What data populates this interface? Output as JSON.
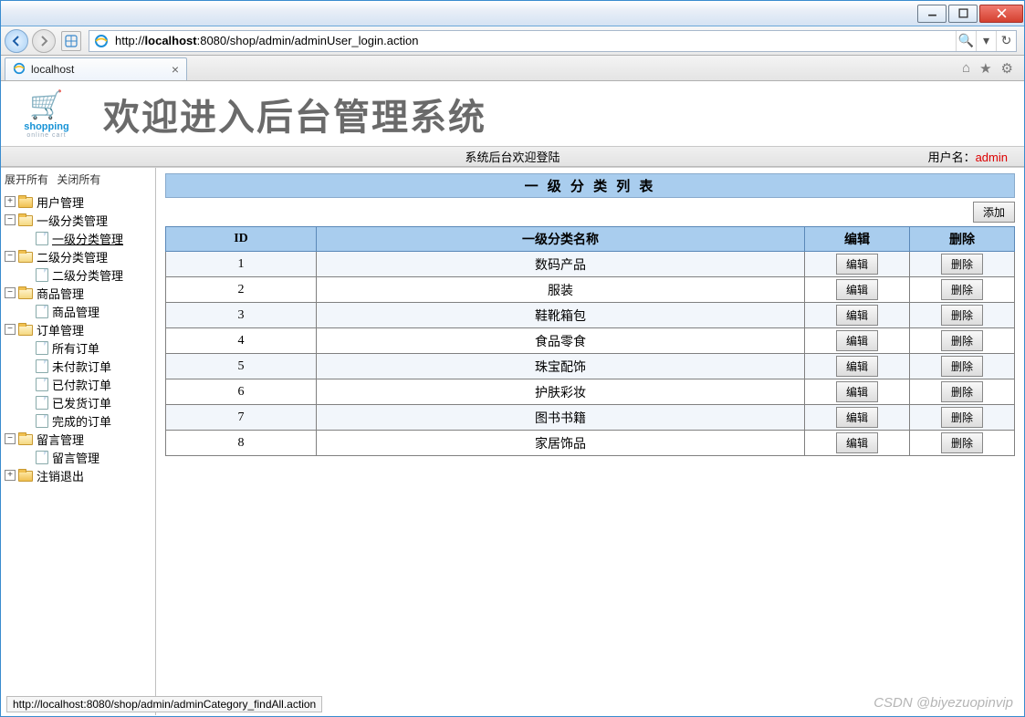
{
  "window": {
    "minimize": "",
    "maximize": "",
    "close": ""
  },
  "browser": {
    "url_pre": "http://",
    "url_host": "localhost",
    "url_post": ":8080/shop/admin/adminUser_login.action",
    "tab_title": "localhost",
    "status": "http://localhost:8080/shop/admin/adminCategory_findAll.action"
  },
  "banner": {
    "logo": "shopping",
    "logo_sub": "online cart",
    "title": "欢迎进入后台管理系统"
  },
  "infobar": {
    "welcome": "系统后台欢迎登陆",
    "user_label": "用户名：",
    "username": "admin"
  },
  "tree": {
    "expand": "展开所有",
    "collapse": "关闭所有",
    "nodes": [
      {
        "label": "用户管理",
        "children": [],
        "collapsed": true
      },
      {
        "label": "一级分类管理",
        "children": [
          {
            "label": "一级分类管理",
            "active": true
          }
        ]
      },
      {
        "label": "二级分类管理",
        "children": [
          {
            "label": "二级分类管理"
          }
        ]
      },
      {
        "label": "商品管理",
        "children": [
          {
            "label": "商品管理"
          }
        ]
      },
      {
        "label": "订单管理",
        "children": [
          {
            "label": "所有订单"
          },
          {
            "label": "未付款订单"
          },
          {
            "label": "已付款订单"
          },
          {
            "label": "已发货订单"
          },
          {
            "label": "完成的订单"
          }
        ]
      },
      {
        "label": "留言管理",
        "children": [
          {
            "label": "留言管理"
          }
        ]
      },
      {
        "label": "注销退出",
        "children": [],
        "collapsed": true
      }
    ]
  },
  "panel": {
    "title": "一 级 分 类 列 表",
    "add_btn": "添加",
    "headers": {
      "id": "ID",
      "name": "一级分类名称",
      "edit": "编辑",
      "delete": "删除"
    },
    "edit_btn": "编辑",
    "del_btn": "删除",
    "rows": [
      {
        "id": "1",
        "name": "数码产品"
      },
      {
        "id": "2",
        "name": "服装"
      },
      {
        "id": "3",
        "name": "鞋靴箱包"
      },
      {
        "id": "4",
        "name": "食品零食"
      },
      {
        "id": "5",
        "name": "珠宝配饰"
      },
      {
        "id": "6",
        "name": "护肤彩妆"
      },
      {
        "id": "7",
        "name": "图书书籍"
      },
      {
        "id": "8",
        "name": "家居饰品"
      }
    ]
  },
  "watermark": "CSDN @biyezuopinvip"
}
